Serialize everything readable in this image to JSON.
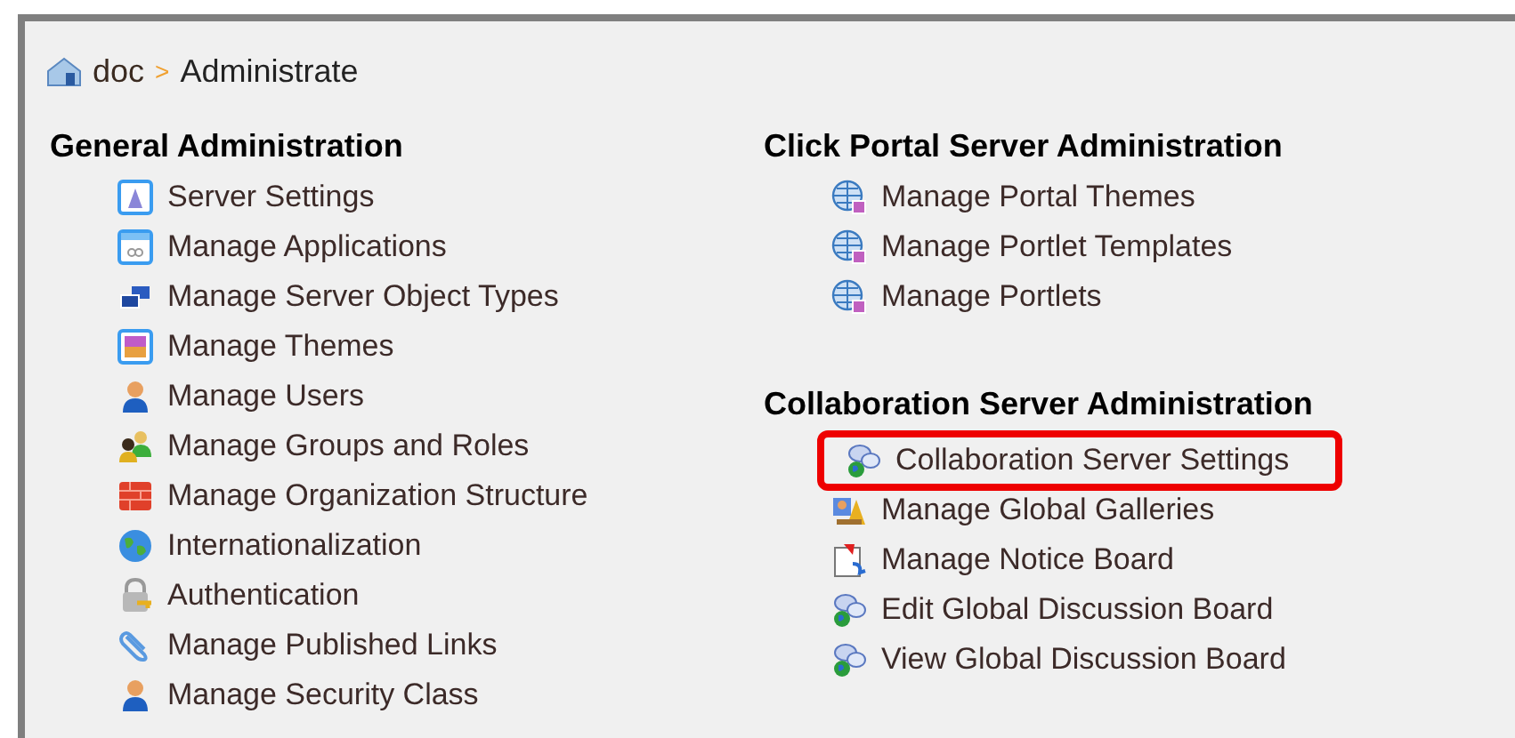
{
  "breadcrumb": {
    "items": [
      "doc",
      "Administrate"
    ],
    "separator": ">"
  },
  "columns": [
    [
      {
        "title": "General Administration",
        "items": [
          {
            "label": "Server Settings",
            "kind": "window",
            "highlighted": false
          },
          {
            "label": "Manage Applications",
            "kind": "app",
            "highlighted": false
          },
          {
            "label": "Manage Server Object Types",
            "kind": "objects",
            "highlighted": false
          },
          {
            "label": "Manage Themes",
            "kind": "theme",
            "highlighted": false
          },
          {
            "label": "Manage Users",
            "kind": "user",
            "highlighted": false
          },
          {
            "label": "Manage Groups and Roles",
            "kind": "group",
            "highlighted": false
          },
          {
            "label": "Manage Organization Structure",
            "kind": "wall",
            "highlighted": false
          },
          {
            "label": "Internationalization",
            "kind": "globe",
            "highlighted": false
          },
          {
            "label": "Authentication",
            "kind": "lock",
            "highlighted": false
          },
          {
            "label": "Manage Published Links",
            "kind": "clip",
            "highlighted": false
          },
          {
            "label": "Manage Security Class",
            "kind": "user",
            "highlighted": false
          }
        ]
      }
    ],
    [
      {
        "title": "Click Portal Server Administration",
        "items": [
          {
            "label": "Manage Portal Themes",
            "kind": "webglobe",
            "highlighted": false
          },
          {
            "label": "Manage Portlet Templates",
            "kind": "webglobe",
            "highlighted": false
          },
          {
            "label": "Manage Portlets",
            "kind": "webglobe",
            "highlighted": false
          }
        ]
      },
      {
        "title": "Collaboration Server Administration",
        "items": [
          {
            "label": "Collaboration Server Settings",
            "kind": "chat",
            "highlighted": true
          },
          {
            "label": "Manage Global Galleries",
            "kind": "gallery",
            "highlighted": false
          },
          {
            "label": "Manage Notice Board",
            "kind": "notice",
            "highlighted": false
          },
          {
            "label": "Edit Global Discussion Board",
            "kind": "chat",
            "highlighted": false
          },
          {
            "label": "View Global Discussion Board",
            "kind": "chat",
            "highlighted": false
          }
        ]
      }
    ]
  ]
}
